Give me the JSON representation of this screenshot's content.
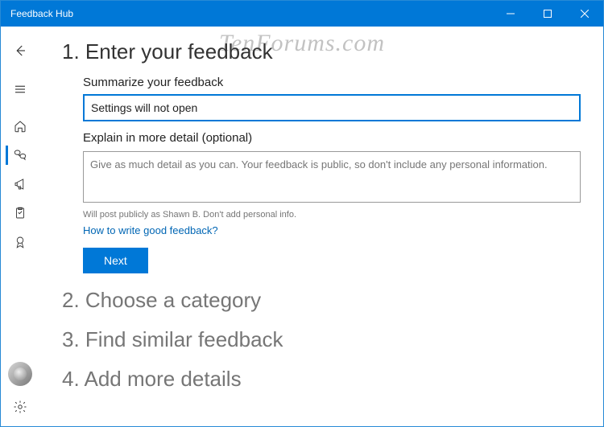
{
  "watermark": "TenForums.com",
  "titlebar": {
    "title": "Feedback Hub"
  },
  "sidebar": {
    "items": [
      {
        "name": "hamburger"
      },
      {
        "name": "home"
      },
      {
        "name": "feedback",
        "active": true
      },
      {
        "name": "announcements"
      },
      {
        "name": "quests"
      },
      {
        "name": "achievements"
      }
    ]
  },
  "steps": {
    "s1": "1. Enter your feedback",
    "s2": "2. Choose a category",
    "s3": "3. Find similar feedback",
    "s4": "4. Add more details"
  },
  "form": {
    "summary_label": "Summarize your feedback",
    "summary_value": "Settings will not open",
    "detail_label": "Explain in more detail (optional)",
    "detail_placeholder": "Give as much detail as you can. Your feedback is public, so don't include any personal information.",
    "privacy_hint": "Will post publicly as Shawn B. Don't add personal info.",
    "help_link": "How to write good feedback?",
    "next_label": "Next"
  }
}
